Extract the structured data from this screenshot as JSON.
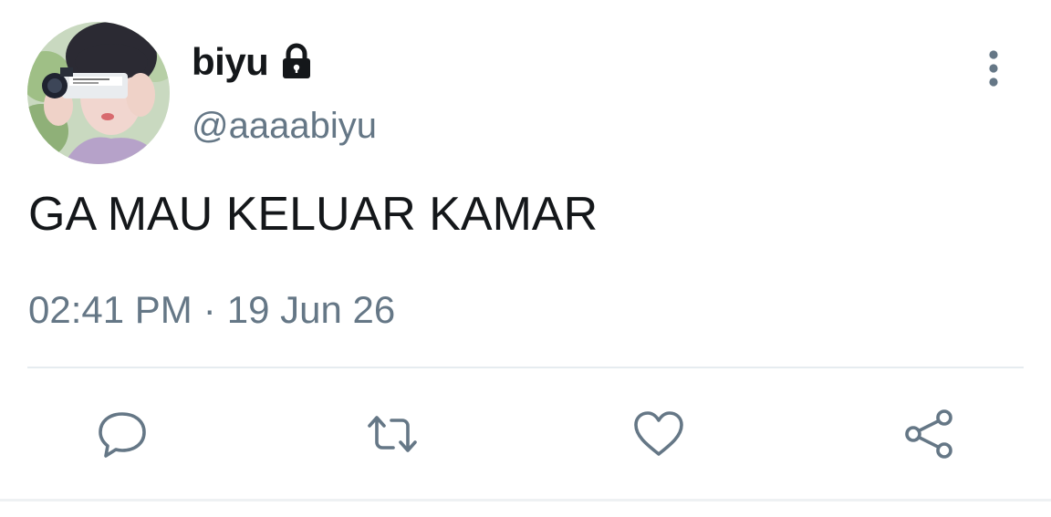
{
  "tweet": {
    "display_name": "biyu",
    "handle": "@aaaabiyu",
    "text": "GA MAU KELUAR KAMAR",
    "time": "02:41 PM",
    "separator": "·",
    "date": "19 Jun 26",
    "account_locked": true
  },
  "icons": {
    "lock": "lock-icon",
    "more": "more-vertical-icon",
    "reply": "reply-icon",
    "retweet": "retweet-icon",
    "like": "heart-icon",
    "share": "share-icon"
  },
  "colors": {
    "text_primary": "#14171a",
    "text_secondary": "#657786",
    "icon_gray": "#657786",
    "divider": "#e6ecf0"
  }
}
